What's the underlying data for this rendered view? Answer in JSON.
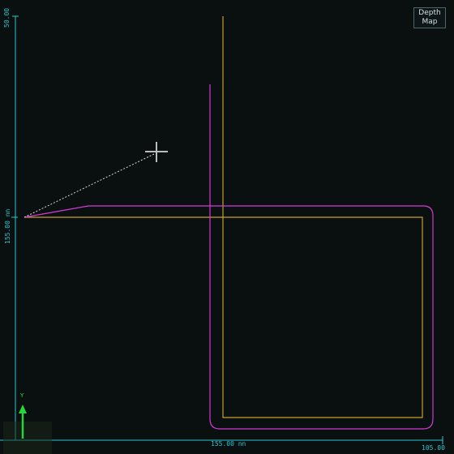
{
  "button": {
    "line1": "Depth",
    "line2": "Map"
  },
  "labels": {
    "y_top": "50.00",
    "y_mid": "155.00 nn",
    "x_mid": "155.00 nn",
    "x_end": "105.00"
  },
  "indicator": {
    "axis_letter": "Y"
  },
  "colors": {
    "axis": "#27c7cf",
    "magenta": "#d23bd6",
    "yellow": "#c9a02a",
    "dotted": "#d8d8d8",
    "green": "#27d53c",
    "background": "#0a0f10"
  }
}
